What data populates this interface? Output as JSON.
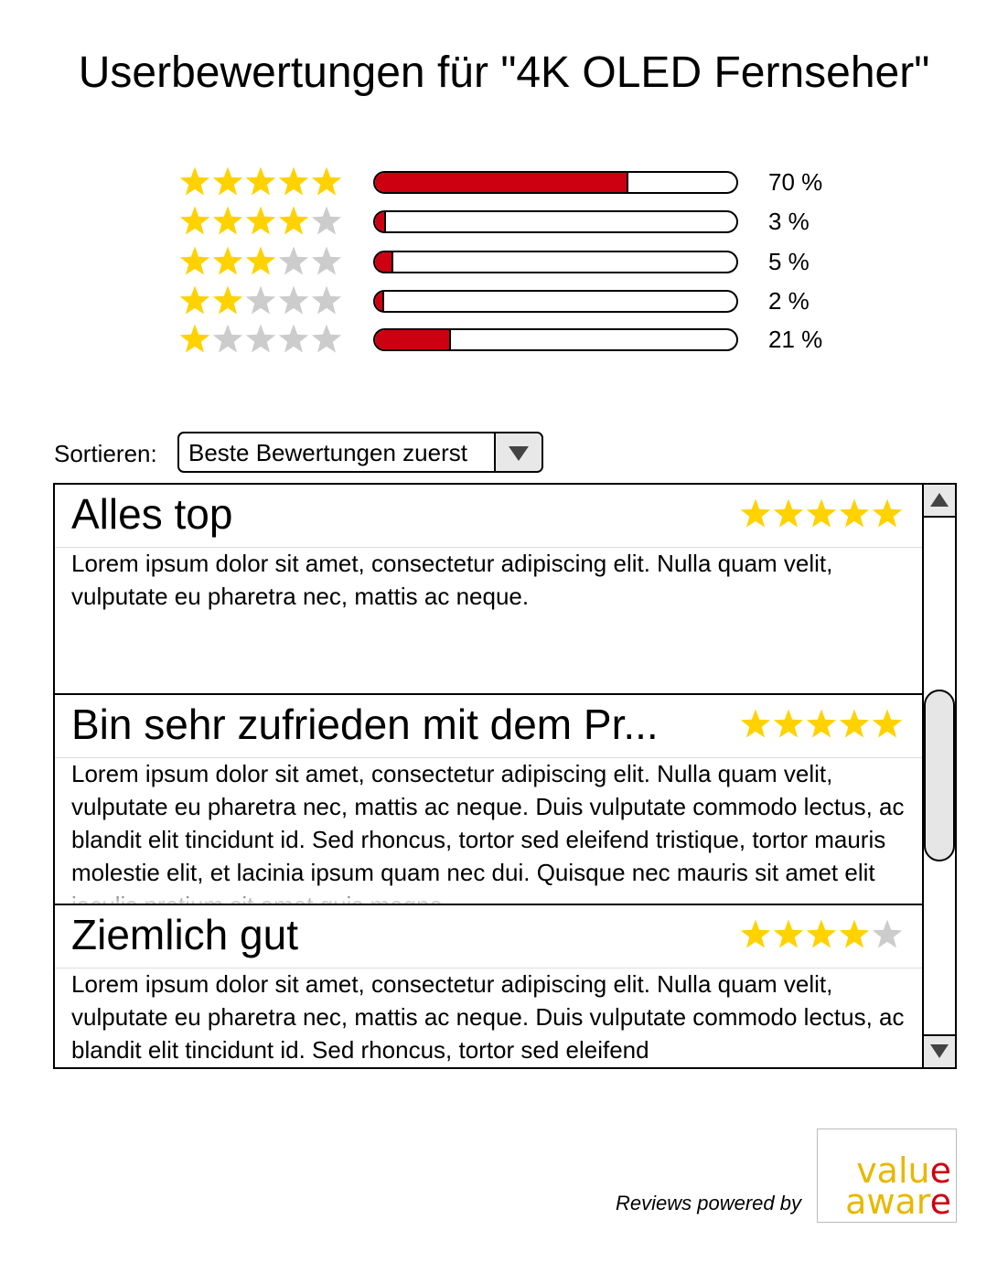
{
  "page_title": "Userbewertungen für \"4K OLED Fernseher\"",
  "colors": {
    "star_filled": "#ffd200",
    "star_empty": "#cccccc",
    "bar_fill": "#cc0011",
    "logo_gold": "#e8b800",
    "logo_red": "#cc0011"
  },
  "distribution": [
    {
      "stars": 5,
      "percent": 70,
      "label": "70 %"
    },
    {
      "stars": 4,
      "percent": 3,
      "label": "3 %"
    },
    {
      "stars": 3,
      "percent": 5,
      "label": "5 %"
    },
    {
      "stars": 2,
      "percent": 2,
      "label": "2 %"
    },
    {
      "stars": 1,
      "percent": 21,
      "label": "21 %"
    }
  ],
  "sort": {
    "label": "Sortieren:",
    "selected": "Beste Bewertungen zuerst"
  },
  "reviews": [
    {
      "title": "Alles top",
      "rating": 5,
      "body": "Lorem ipsum dolor sit amet, consectetur adipiscing elit. Nulla quam velit, vulputate eu pharetra nec, mattis ac neque."
    },
    {
      "title": "Bin sehr zufrieden mit dem Pr...",
      "rating": 5,
      "body": "Lorem ipsum dolor sit amet, consectetur adipiscing elit. Nulla quam velit, vulputate eu pharetra nec, mattis ac neque. Duis vulputate commodo lectus, ac blandit elit tincidunt id. Sed rhoncus, tortor sed eleifend tristique, tortor mauris molestie elit, et lacinia ipsum quam nec dui. Quisque nec mauris sit amet elit iaculis pretium sit amet quis magna."
    },
    {
      "title": "Ziemlich gut",
      "rating": 4,
      "body": "Lorem ipsum dolor sit amet, consectetur adipiscing elit. Nulla quam velit, vulputate eu pharetra nec, mattis ac neque. Duis vulputate commodo lectus, ac blandit elit tincidunt id. Sed rhoncus, tortor sed eleifend"
    }
  ],
  "footer": {
    "powered_by": "Reviews powered by",
    "logo_line1": "value",
    "logo_line2": "aware"
  },
  "icons": {
    "star": "star-icon",
    "dropdown": "chevron-down-icon",
    "scroll_up": "scroll-up-arrow-icon",
    "scroll_down": "scroll-down-arrow-icon"
  }
}
